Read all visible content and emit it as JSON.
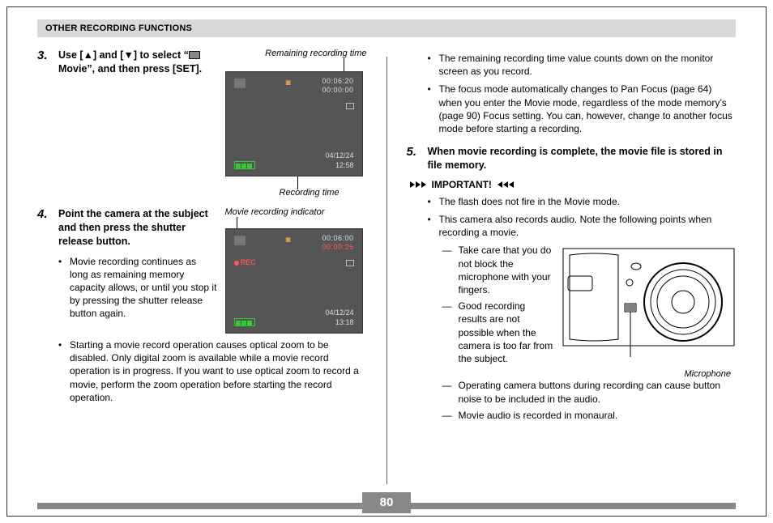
{
  "header": {
    "title": "OTHER RECORDING FUNCTIONS"
  },
  "page_number": "80",
  "steps": {
    "s3": {
      "num": "3.",
      "text_a": "Use [",
      "text_b": "] and [",
      "text_c": "] to select “",
      "text_d": " Movie”, and then press [SET]."
    },
    "s4": {
      "num": "4.",
      "text": "Point the camera at the subject and then press the shutter release button."
    },
    "s5": {
      "num": "5.",
      "text": "When movie recording is complete, the movie file is stored in file memory."
    }
  },
  "captions": {
    "remaining": "Remaining recording time",
    "recording_time": "Recording time",
    "movie_indicator": "Movie recording indicator",
    "microphone": "Microphone"
  },
  "lcd1": {
    "t1": "00:06:20",
    "t2": "00:00:00",
    "date": "04/12/24",
    "time": "12:58"
  },
  "lcd2": {
    "rec": "REC",
    "t1": "00:06:00",
    "t2": "00:00:26",
    "date": "04/12/24",
    "time": "13:18"
  },
  "bullets_left": {
    "b1": "Movie recording continues as long as remaining memory capacity allows, or until you stop it by pressing the shutter release button again.",
    "b2": "Starting a movie record operation causes optical zoom to be disabled. Only digital zoom is available while a movie record operation is in progress. If you want to use optical zoom to record a movie, perform the zoom operation before starting the record operation."
  },
  "bullets_right": {
    "b1": "The remaining recording time value counts down on the monitor screen as you record.",
    "b2": "The focus mode automatically changes to Pan Focus (page 64) when you enter the Movie mode, regardless of the mode memory’s (page 90) Focus setting. You can, however, change to another focus mode before starting a recording."
  },
  "important": {
    "label": "IMPORTANT!",
    "b1": "The flash does not fire in the Movie mode.",
    "b2": "This camera also records audio. Note the following points when recording a movie.",
    "d1": "Take care that you do not block the microphone with your fingers.",
    "d2": "Good recording results are not possible when the camera is too far from the subject.",
    "d3": "Operating camera buttons during recording can cause button noise to be included in the audio.",
    "d4": "Movie audio is recorded in monaural."
  }
}
